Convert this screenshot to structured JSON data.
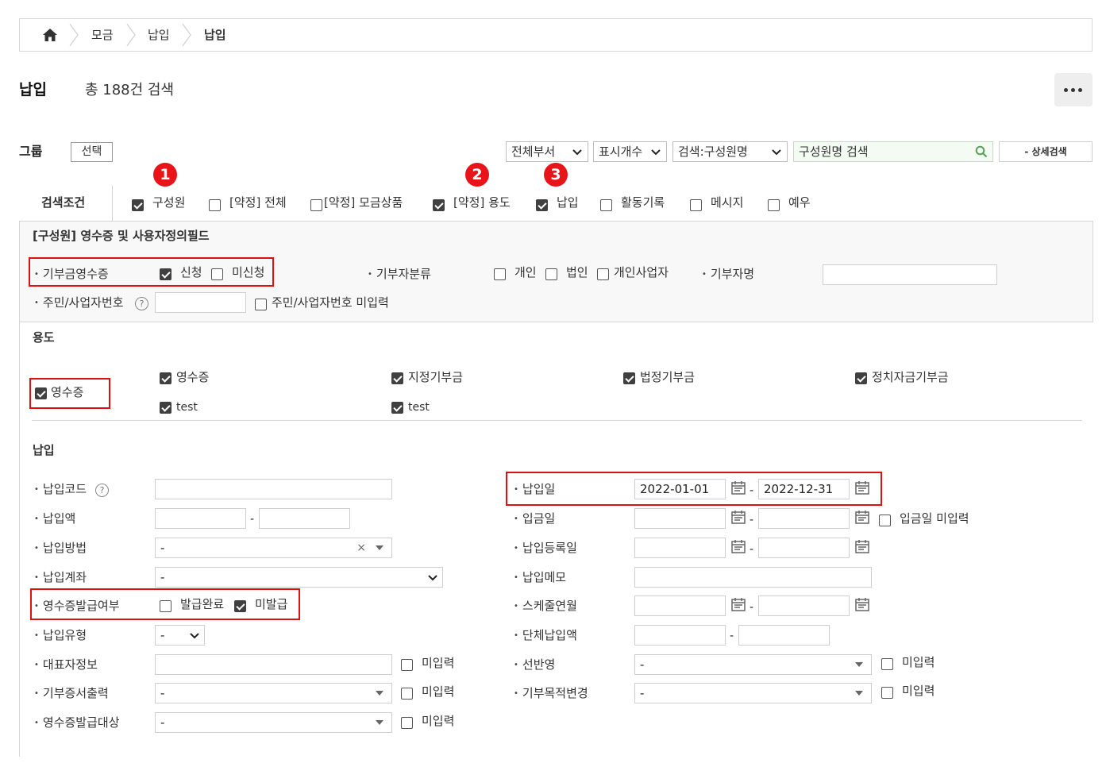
{
  "breadcrumb": {
    "items": [
      "모금",
      "납입",
      "납입"
    ]
  },
  "header": {
    "title": "납입",
    "subtitle": "총 188건 검색"
  },
  "toolbar": {
    "group_label": "그룹",
    "select_button": "선택",
    "dept_select": "전체부서",
    "count_select": "표시개수",
    "search_type": "검색:구성원명",
    "search_placeholder": "구성원명 검색",
    "detail_search": "- 상세검색"
  },
  "badges": [
    "1",
    "2",
    "3"
  ],
  "conditions": {
    "label": "검색조건",
    "items": [
      {
        "label": "구성원",
        "checked": true
      },
      {
        "label": "[약정] 전체",
        "checked": false
      },
      {
        "label": "[약정] 모금상품",
        "checked": false
      },
      {
        "label": "[약정] 용도",
        "checked": true
      },
      {
        "label": "납입",
        "checked": true
      },
      {
        "label": "활동기록",
        "checked": false
      },
      {
        "label": "메시지",
        "checked": false
      },
      {
        "label": "예우",
        "checked": false
      }
    ]
  },
  "member_section": {
    "title": "[구성원] 영수증 및 사용자정의필드",
    "receipt_label": "기부금영수증",
    "receipt_applied": "신청",
    "receipt_not_applied": "미신청",
    "donor_type_label": "기부자분류",
    "donor_types": [
      "개인",
      "법인",
      "개인사업자"
    ],
    "donor_name_label": "기부자명",
    "id_label": "주민/사업자번호",
    "id_missing": "주민/사업자번호 미입력"
  },
  "purpose_section": {
    "title": "용도",
    "main_label": "영수증",
    "items": [
      "영수증",
      "지정기부금",
      "법정기부금",
      "정치자금기부금",
      "test",
      "test"
    ]
  },
  "payment_section": {
    "title": "납입",
    "left": {
      "code": "납입코드",
      "amount": "납입액",
      "method": "납입방법",
      "method_value": "-",
      "account": "납입계좌",
      "account_value": "-",
      "receipt_issue": "영수증발급여부",
      "issued": "발급완료",
      "not_issued": "미발급",
      "type": "납입유형",
      "type_value": "-",
      "rep_info": "대표자정보",
      "cert_print": "기부증서출력",
      "cert_print_value": "-",
      "receipt_target": "영수증발급대상",
      "receipt_target_value": "-",
      "missing": "미입력"
    },
    "right": {
      "pay_date": "납입일",
      "pay_date_from": "2022-01-01",
      "pay_date_to": "2022-12-31",
      "deposit_date": "입금일",
      "deposit_missing": "입금일 미입력",
      "reg_date": "납입등록일",
      "memo": "납입메모",
      "schedule": "스케줄연월",
      "group_amount": "단체납입액",
      "prior_reflect": "선반영",
      "prior_value": "-",
      "purpose_change": "기부목적변경",
      "purpose_change_value": "-",
      "missing": "미입력"
    }
  }
}
